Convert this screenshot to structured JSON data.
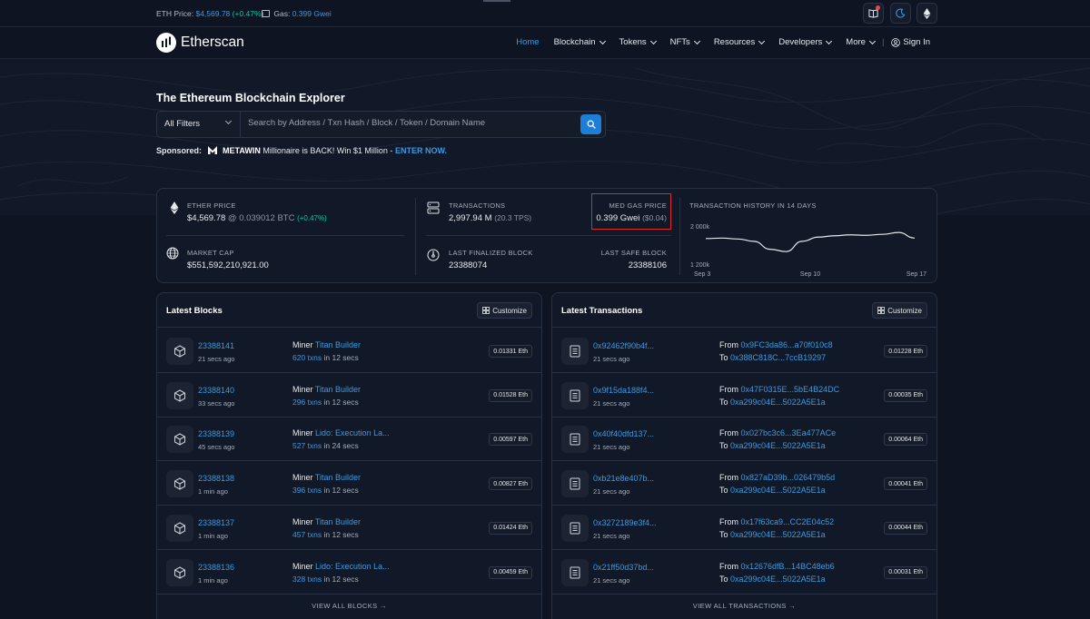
{
  "topbar": {
    "eth_price_label": "ETH Price:",
    "eth_price_value": "$4,569.78",
    "eth_price_change": "(+0.47%)",
    "gas_label": "Gas:",
    "gas_value": "0.399 Gwei"
  },
  "header": {
    "logo_text": "Etherscan",
    "nav": [
      {
        "label": "Home",
        "active": true
      },
      {
        "label": "Blockchain"
      },
      {
        "label": "Tokens"
      },
      {
        "label": "NFTs"
      },
      {
        "label": "Resources"
      },
      {
        "label": "Developers"
      },
      {
        "label": "More"
      }
    ],
    "signin_label": "Sign In"
  },
  "hero": {
    "title": "The Ethereum Blockchain Explorer",
    "filter_label": "All Filters",
    "search_placeholder": "Search by Address / Txn Hash / Block / Token / Domain Name",
    "sponsored_label": "Sponsored:",
    "sponsor_name": "METAWIN",
    "sponsor_text": "Millionaire is BACK! Win $1 Million -",
    "sponsor_cta": "ENTER NOW."
  },
  "stats": {
    "ether_price_label": "ETHER PRICE",
    "ether_price_usd": "$4,569.78",
    "ether_price_btc": "@ 0.039012 BTC",
    "ether_price_change": "(+0.47%)",
    "market_cap_label": "MARKET CAP",
    "market_cap_value": "$551,592,210,921.00",
    "transactions_label": "TRANSACTIONS",
    "transactions_value": "2,997.94 M",
    "transactions_tps": "(20.3 TPS)",
    "gas_label": "MED GAS PRICE",
    "gas_value": "0.399 Gwei",
    "gas_usd": "($0.04)",
    "finalized_label": "LAST FINALIZED BLOCK",
    "finalized_value": "23388074",
    "safe_label": "LAST SAFE BLOCK",
    "safe_value": "23388106",
    "history_label": "TRANSACTION HISTORY IN 14 DAYS"
  },
  "chart_data": {
    "type": "line",
    "title": "TRANSACTION HISTORY IN 14 DAYS",
    "yticks": [
      "2 000k",
      "1 200k"
    ],
    "ylim": [
      1200,
      2000
    ],
    "xticks": [
      "Sep 3",
      "Sep 10",
      "Sep 17"
    ],
    "series": [
      {
        "values": [
          1750,
          1760,
          1740,
          1690,
          1520,
          1470,
          1690,
          1780,
          1810,
          1830,
          1820,
          1840,
          1880,
          1760
        ]
      }
    ]
  },
  "latest_blocks": {
    "title": "Latest Blocks",
    "customize_label": "Customize",
    "miner_label": "Miner",
    "view_all": "VIEW ALL BLOCKS →",
    "rows": [
      {
        "block": "23388141",
        "time": "21 secs ago",
        "miner": "Titan Builder",
        "txns": "620 txns",
        "in": "in 12 secs",
        "reward": "0.01331 Eth"
      },
      {
        "block": "23388140",
        "time": "33 secs ago",
        "miner": "Titan Builder",
        "txns": "296 txns",
        "in": "in 12 secs",
        "reward": "0.01528 Eth"
      },
      {
        "block": "23388139",
        "time": "45 secs ago",
        "miner": "Lido: Execution La...",
        "txns": "527 txns",
        "in": "in 24 secs",
        "reward": "0.00597 Eth"
      },
      {
        "block": "23388138",
        "time": "1 min ago",
        "miner": "Titan Builder",
        "txns": "396 txns",
        "in": "in 12 secs",
        "reward": "0.00827 Eth"
      },
      {
        "block": "23388137",
        "time": "1 min ago",
        "miner": "Titan Builder",
        "txns": "457 txns",
        "in": "in 12 secs",
        "reward": "0.01424 Eth"
      },
      {
        "block": "23388136",
        "time": "1 min ago",
        "miner": "Lido: Execution La...",
        "txns": "328 txns",
        "in": "in 12 secs",
        "reward": "0.00459 Eth"
      }
    ]
  },
  "latest_transactions": {
    "title": "Latest Transactions",
    "customize_label": "Customize",
    "from_label": "From",
    "to_label": "To",
    "view_all": "VIEW ALL TRANSACTIONS →",
    "rows": [
      {
        "hash": "0x92462f90b4f...",
        "time": "21 secs ago",
        "from": "0x9FC3da86...a70f010c8",
        "to": "0x388C818C...7ccB19297",
        "value": "0.01228 Eth"
      },
      {
        "hash": "0x9f15da188f4...",
        "time": "21 secs ago",
        "from": "0x47F0315E...5bE4B24DC",
        "to": "0xa299c04E...5022A5E1a",
        "value": "0.00035 Eth"
      },
      {
        "hash": "0x40f40dfd137...",
        "time": "21 secs ago",
        "from": "0x027bc3c6...3Ea477ACe",
        "to": "0xa299c04E...5022A5E1a",
        "value": "0.00064 Eth"
      },
      {
        "hash": "0xb21e8e407b...",
        "time": "21 secs ago",
        "from": "0x827aD39b...026479b5d",
        "to": "0xa299c04E...5022A5E1a",
        "value": "0.00041 Eth"
      },
      {
        "hash": "0x3272189e3f4...",
        "time": "21 secs ago",
        "from": "0x17f63ca9...CC2E04c52",
        "to": "0xa299c04E...5022A5E1a",
        "value": "0.00044 Eth"
      },
      {
        "hash": "0x21ff50d37bd...",
        "time": "21 secs ago",
        "from": "0x12676dfB...14BC48eb6",
        "to": "0xa299c04E...5022A5E1a",
        "value": "0.00031 Eth"
      }
    ]
  }
}
